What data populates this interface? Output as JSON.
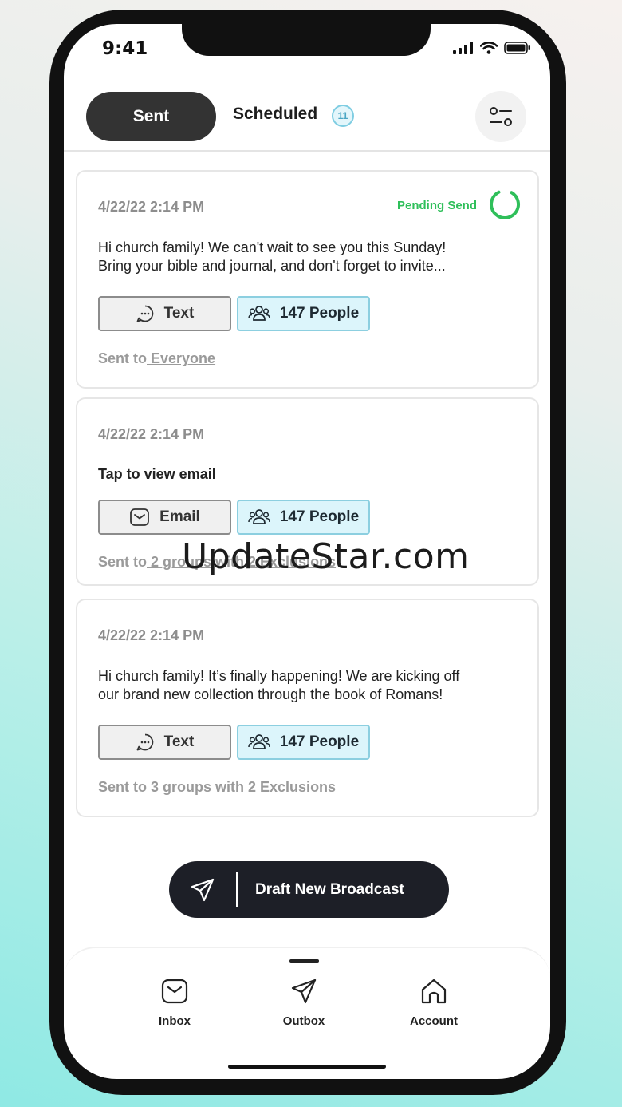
{
  "status_bar": {
    "time": "9:41"
  },
  "tabs": {
    "sent_label": "Sent",
    "scheduled_label": "Scheduled",
    "scheduled_count": "11"
  },
  "cards": [
    {
      "date": "4/22/22 2:14 PM",
      "status": "Pending Send",
      "message_line1": "Hi church family! We can't wait to see you this Sunday!",
      "message_line2": "Bring your bible and journal, and don't forget to invite...",
      "type_label": "Text",
      "people_label": "147 People",
      "sent_prefix": "Sent to",
      "sent_target": " Everyone"
    },
    {
      "date": "4/22/22 2:14 PM",
      "view_link": "Tap to view email",
      "type_label": "Email",
      "people_label": "147 People",
      "sent_prefix": "Sent to",
      "sent_target": " 2 groups",
      "sent_with": " with ",
      "sent_exclusions": "2 Exclusions"
    },
    {
      "date": "4/22/22 2:14 PM",
      "message_line1": "Hi church family! It’s finally happening! We are kicking off",
      "message_line2": "our brand new collection through the book of Romans!",
      "type_label": "Text",
      "people_label": "147 People",
      "sent_prefix": "Sent to",
      "sent_target": " 3 groups",
      "sent_with": " with ",
      "sent_exclusions": "2 Exclusions"
    }
  ],
  "draft_button": {
    "label": "Draft New Broadcast"
  },
  "bottom_nav": {
    "inbox": "Inbox",
    "outbox": "Outbox",
    "account": "Account"
  },
  "watermark": "UpdateStar.com",
  "colors": {
    "pending_green": "#2fbf5a",
    "people_bg": "#dcf5fb",
    "dark_button": "#1d1f27"
  },
  "icons": {
    "filter": "sliders-icon",
    "spinner": "progress-ring-icon",
    "text": "chat-bubble-icon",
    "email": "envelope-icon",
    "people": "people-icon",
    "send": "paper-plane-icon",
    "home": "home-icon"
  }
}
